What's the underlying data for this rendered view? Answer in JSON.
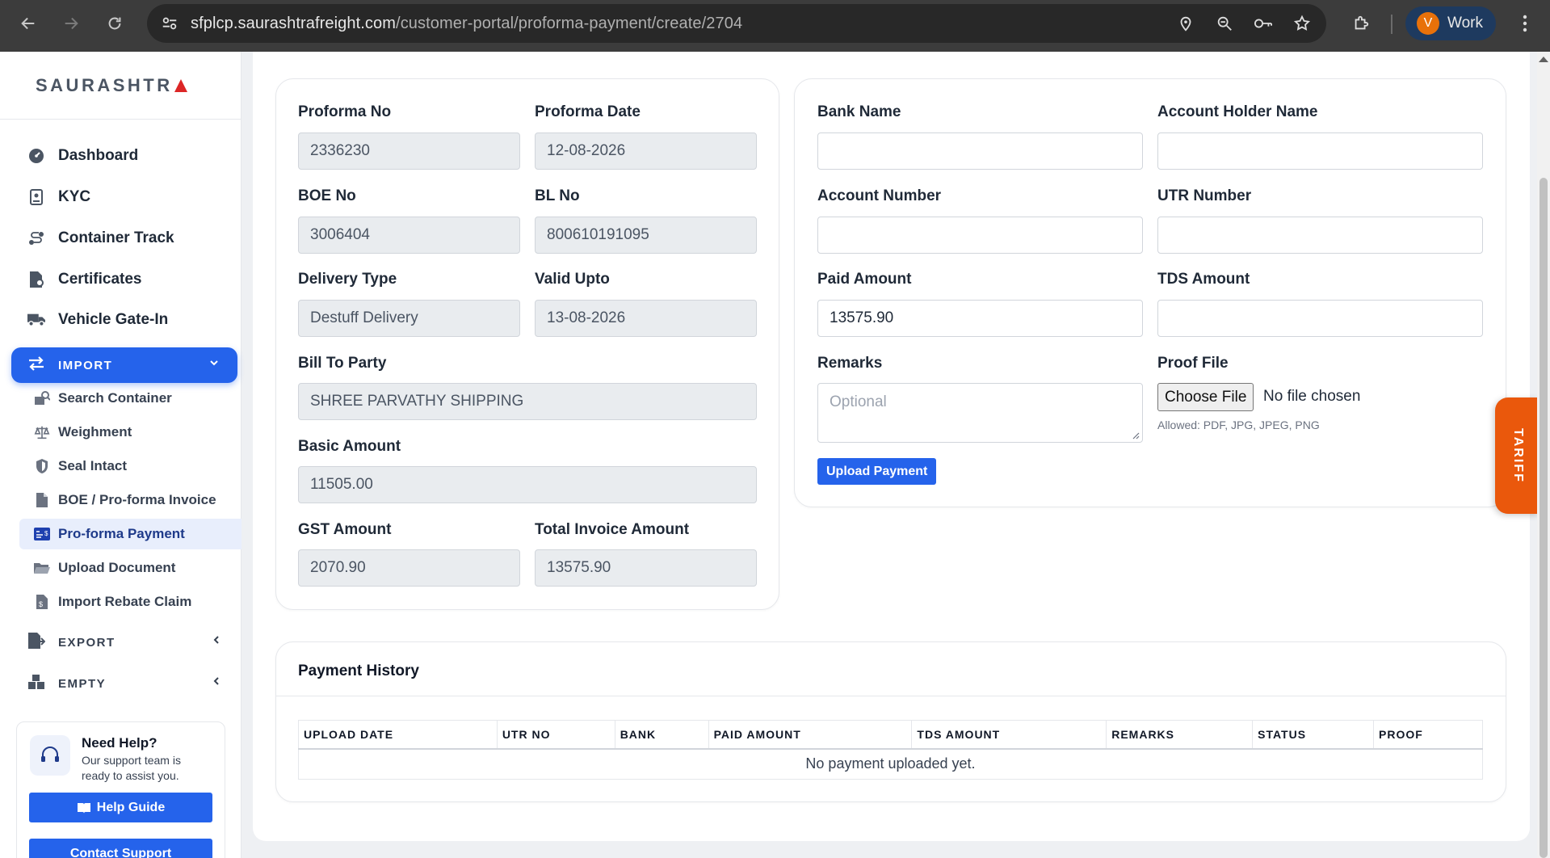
{
  "browser": {
    "url_host": "sfplcp.saurashtrafreight.com",
    "url_path": "/customer-portal/proforma-payment/create/2704",
    "profile_initial": "V",
    "profile_name": "Work"
  },
  "sidebar": {
    "logo": "SAURASHTR",
    "items": [
      {
        "label": "Dashboard",
        "icon": "dashboard-gauge-icon"
      },
      {
        "label": "KYC",
        "icon": "id-badge-icon"
      },
      {
        "label": "Container Track",
        "icon": "route-icon"
      },
      {
        "label": "Certificates",
        "icon": "certificate-icon"
      },
      {
        "label": "Vehicle Gate-In",
        "icon": "truck-icon"
      }
    ],
    "import_label": "IMPORT",
    "import_items": [
      {
        "label": "Search Container",
        "icon": "container-search-icon"
      },
      {
        "label": "Weighment",
        "icon": "scale-icon"
      },
      {
        "label": "Seal Intact",
        "icon": "shield-icon"
      },
      {
        "label": "BOE / Pro-forma Invoice",
        "icon": "pdf-file-icon"
      },
      {
        "label": "Pro-forma Payment",
        "icon": "payment-card-icon",
        "active": true
      },
      {
        "label": "Upload Document",
        "icon": "folder-icon"
      },
      {
        "label": "Import Rebate Claim",
        "icon": "invoice-dollar-icon"
      }
    ],
    "export_label": "EXPORT",
    "empty_label": "EMPTY",
    "help": {
      "title": "Need Help?",
      "subtitle": "Our support team is ready to assist you.",
      "guide_button": "Help Guide",
      "contact_button": "Contact Support"
    }
  },
  "proforma": {
    "proforma_no_label": "Proforma No",
    "proforma_no": "2336230",
    "proforma_date_label": "Proforma Date",
    "proforma_date": "12-08-2026",
    "boe_no_label": "BOE No",
    "boe_no": "3006404",
    "bl_no_label": "BL No",
    "bl_no": "800610191095",
    "delivery_type_label": "Delivery Type",
    "delivery_type": "Destuff Delivery",
    "valid_upto_label": "Valid Upto",
    "valid_upto": "13-08-2026",
    "bill_to_party_label": "Bill To Party",
    "bill_to_party": "SHREE PARVATHY SHIPPING",
    "basic_amount_label": "Basic Amount",
    "basic_amount": "11505.00",
    "gst_amount_label": "GST Amount",
    "gst_amount": "2070.90",
    "total_invoice_label": "Total Invoice Amount",
    "total_invoice": "13575.90"
  },
  "payment_form": {
    "bank_name_label": "Bank Name",
    "bank_name": "",
    "account_holder_label": "Account Holder Name",
    "account_holder": "",
    "account_number_label": "Account Number",
    "account_number": "",
    "utr_number_label": "UTR Number",
    "utr_number": "",
    "paid_amount_label": "Paid Amount",
    "paid_amount": "13575.90",
    "tds_amount_label": "TDS Amount",
    "tds_amount": "",
    "remarks_label": "Remarks",
    "remarks_placeholder": "Optional",
    "proof_file_label": "Proof File",
    "choose_file": "Choose File",
    "no_file": "No file chosen",
    "allowed": "Allowed: PDF, JPG, JPEG, PNG",
    "upload_button": "Upload Payment"
  },
  "tariff_label": "TARIFF",
  "payment_history": {
    "title": "Payment History",
    "columns": [
      "UPLOAD DATE",
      "UTR NO",
      "BANK",
      "PAID AMOUNT",
      "TDS AMOUNT",
      "REMARKS",
      "STATUS",
      "PROOF"
    ],
    "empty_message": "No payment uploaded yet."
  },
  "colors": {
    "accent": "#2563eb",
    "tariff": "#ea580c",
    "readonly_bg": "#e9ecef"
  }
}
